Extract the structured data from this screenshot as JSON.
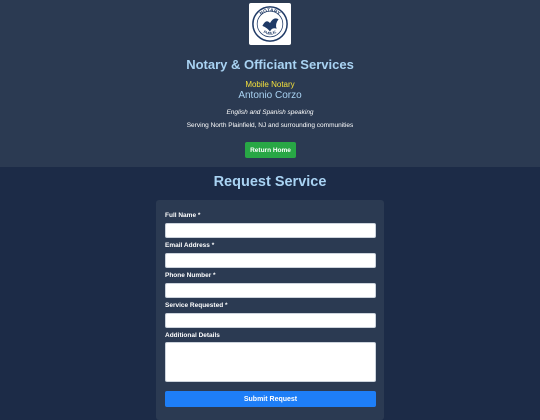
{
  "header": {
    "logo": {
      "name": "notary-public-seal",
      "text_top": "NOTARY",
      "text_bottom": "PUBLIC"
    },
    "title": "Notary & Officiant Services",
    "tagline": "Mobile Notary",
    "person": "Antonio Corzo",
    "languages": "English and Spanish speaking",
    "serving": "Serving North Plainfield, NJ and surrounding communities",
    "return_button": "Return Home"
  },
  "form": {
    "title": "Request Service",
    "fields": [
      {
        "label": "Full Name *",
        "value": "",
        "placeholder": ""
      },
      {
        "label": "Email Address *",
        "value": "",
        "placeholder": ""
      },
      {
        "label": "Phone Number *",
        "value": "",
        "placeholder": ""
      },
      {
        "label": "Service Requested *",
        "value": "",
        "placeholder": ""
      },
      {
        "label": "Additional Details",
        "value": "",
        "placeholder": ""
      }
    ],
    "submit_button": "Submit Request"
  },
  "colors": {
    "header_bg": "#2b3a52",
    "page_bg": "#1c2b47",
    "title_blue": "#a9d3f3",
    "tagline_yellow": "#f5e13c",
    "return_green": "#28a745",
    "submit_blue": "#1e7ef7"
  }
}
